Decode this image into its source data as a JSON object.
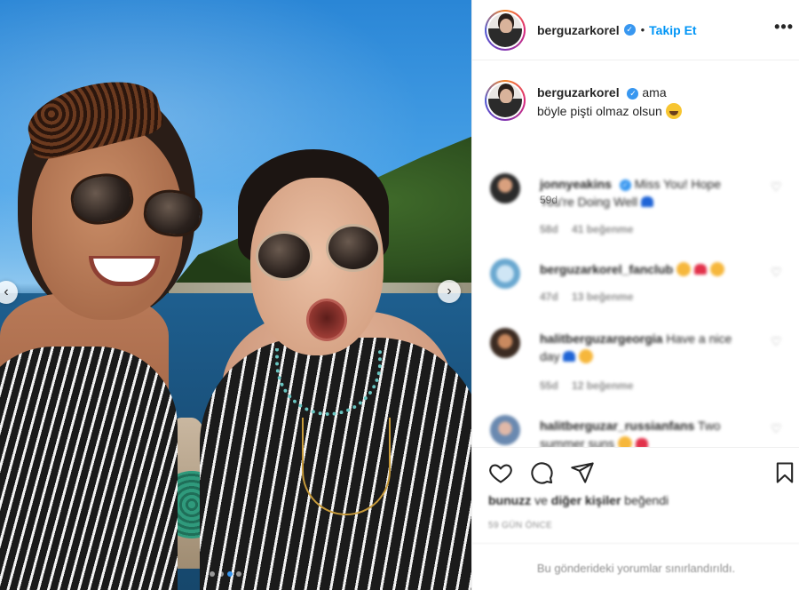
{
  "post": {
    "username": "berguzarkorel",
    "follow_label": "Takip Et",
    "more_label": "•••",
    "separator": "•",
    "caption_text": "ama böyle pişti olmaz olsun",
    "caption_time": "59d",
    "carousel": {
      "total_images": 4,
      "active_index": 2,
      "prev_label": "‹",
      "next_label": "›"
    }
  },
  "comments": [
    {
      "username": "jonnyeakins",
      "text": "Miss You! Hope You're Doing Well",
      "time": "58d",
      "likes": "41 beğenme"
    },
    {
      "username": "berguzarkorel_fanclub",
      "text": "",
      "time": "47d",
      "likes": "13 beğenme"
    },
    {
      "username": "halitberguzargeorgia",
      "text": "Have a nice day",
      "time": "55d",
      "likes": "12 beğenme"
    },
    {
      "username": "halitberguzar_russianfans",
      "text": "Two summer suns"
    }
  ],
  "likes_summary": {
    "user": "bunuzz",
    "connector": "ve",
    "others": "diğer kişiler",
    "suffix": "beğendi"
  },
  "posted_time": "59 GÜN ÖNCE",
  "comments_limited": "Bu gönderideki yorumlar sınırlandırıldı.",
  "colors": {
    "accent": "#0095f6",
    "verified": "#3897f0",
    "muted": "#8e8e8e",
    "text": "#262626"
  },
  "icons": [
    "heart-icon",
    "comment-icon",
    "share-icon",
    "bookmark-icon",
    "verified-icon",
    "more-icon"
  ]
}
